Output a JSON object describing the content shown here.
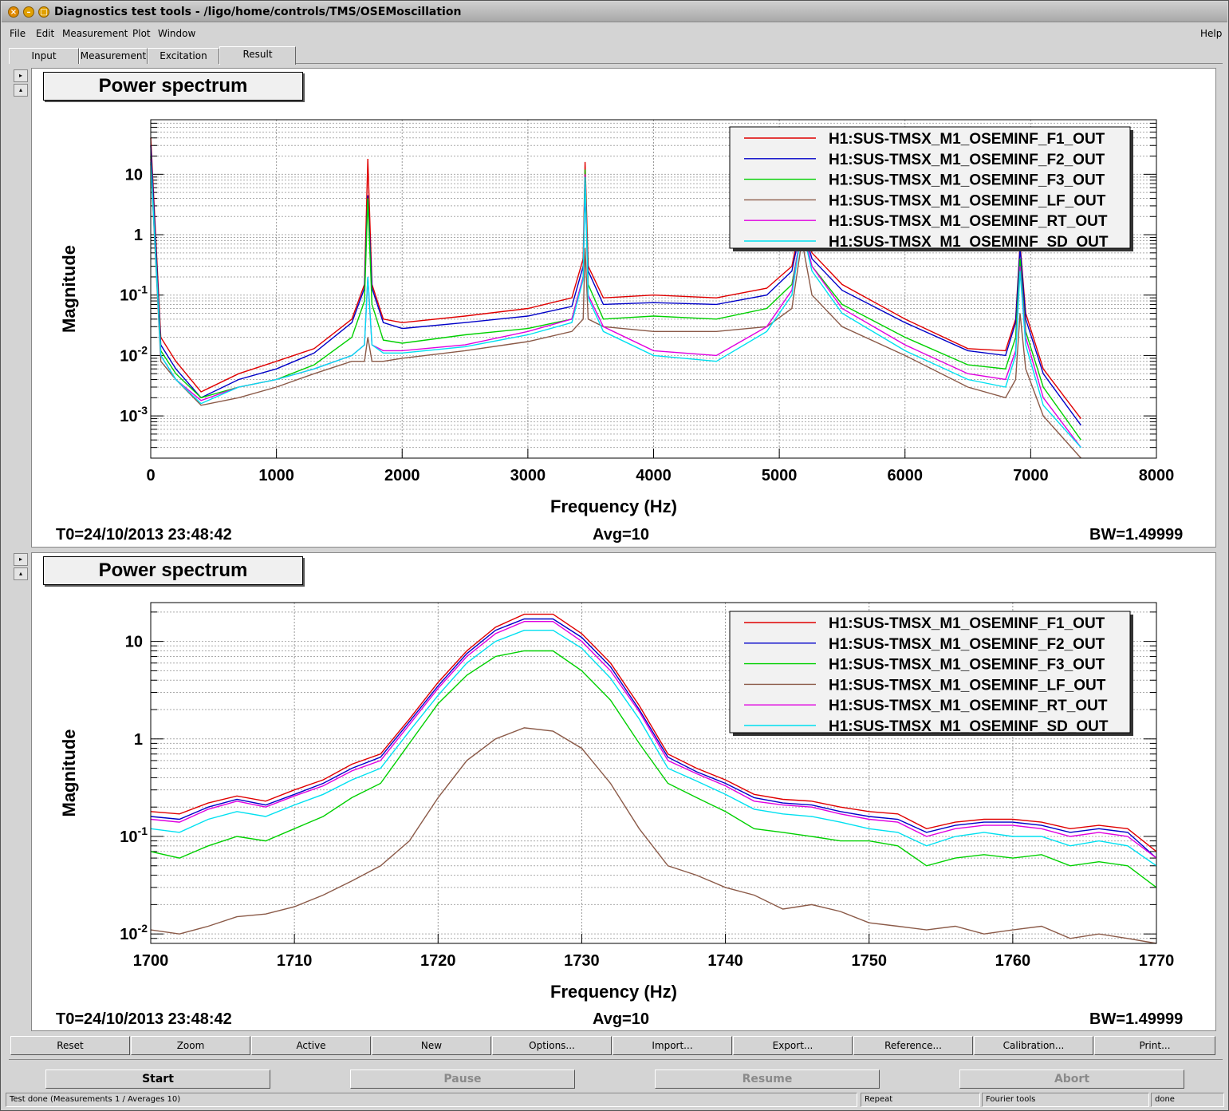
{
  "window": {
    "title": "Diagnostics test tools - /ligo/home/controls/TMS/OSEMoscillation"
  },
  "menubar": {
    "items": [
      "File",
      "Edit",
      "Measurement",
      "Plot",
      "Window"
    ],
    "help": "Help"
  },
  "tabs": [
    {
      "label": "Input",
      "active": false
    },
    {
      "label": "Measurement",
      "active": false
    },
    {
      "label": "Excitation",
      "active": false
    },
    {
      "label": "Result",
      "active": true
    }
  ],
  "legend_entries": [
    "H1:SUS-TMSX_M1_OSEMINF_F1_OUT",
    "H1:SUS-TMSX_M1_OSEMINF_F2_OUT",
    "H1:SUS-TMSX_M1_OSEMINF_F3_OUT",
    "H1:SUS-TMSX_M1_OSEMINF_LF_OUT",
    "H1:SUS-TMSX_M1_OSEMINF_RT_OUT",
    "H1:SUS-TMSX_M1_OSEMINF_SD_OUT"
  ],
  "series_colors": [
    "#e00000",
    "#0000c8",
    "#00d000",
    "#8b5a48",
    "#e000e0",
    "#00e0f0"
  ],
  "plots": [
    {
      "title": "Power spectrum",
      "t0": "T0=24/10/2013 23:48:42",
      "avg": "Avg=10",
      "bw": "BW=1.49999"
    },
    {
      "title": "Power spectrum",
      "t0": "T0=24/10/2013 23:48:42",
      "avg": "Avg=10",
      "bw": "BW=1.49999"
    }
  ],
  "chart_data": [
    {
      "type": "line",
      "title": "Power spectrum",
      "xlabel": "Frequency (Hz)",
      "ylabel": "Magnitude",
      "xlim": [
        0,
        8000
      ],
      "ylim": [
        0.0002,
        80
      ],
      "yscale": "log",
      "grid": true,
      "legend": "top-right",
      "xticks": [
        "0",
        "1000",
        "2000",
        "3000",
        "4000",
        "5000",
        "6000",
        "7000",
        "8000"
      ],
      "xtick_values": [
        0,
        1000,
        2000,
        3000,
        4000,
        5000,
        6000,
        7000,
        8000
      ],
      "ytick_values": [
        0.001,
        0.01,
        0.1,
        1,
        10
      ],
      "series": [
        {
          "name": "H1:SUS-TMSX_M1_OSEMINF_F1_OUT",
          "x": [
            0,
            80,
            200,
            400,
            700,
            1000,
            1300,
            1600,
            1700,
            1727,
            1760,
            1850,
            2000,
            2500,
            3000,
            3350,
            3440,
            3455,
            3480,
            3600,
            4000,
            4500,
            4900,
            5100,
            5180,
            5260,
            5500,
            6000,
            6500,
            6800,
            6880,
            6915,
            6960,
            7100,
            7400
          ],
          "y": [
            40,
            0.02,
            0.008,
            0.0025,
            0.005,
            0.008,
            0.013,
            0.04,
            0.15,
            18,
            0.15,
            0.04,
            0.035,
            0.045,
            0.06,
            0.09,
            0.4,
            16,
            0.3,
            0.09,
            0.1,
            0.09,
            0.13,
            0.3,
            2,
            0.5,
            0.15,
            0.04,
            0.013,
            0.012,
            0.04,
            0.7,
            0.05,
            0.006,
            0.0009
          ]
        },
        {
          "name": "H1:SUS-TMSX_M1_OSEMINF_F2_OUT",
          "x": [
            0,
            80,
            200,
            400,
            700,
            1000,
            1300,
            1600,
            1700,
            1727,
            1760,
            1850,
            2000,
            2500,
            3000,
            3350,
            3440,
            3455,
            3480,
            3600,
            4000,
            4500,
            4900,
            5100,
            5180,
            5260,
            5500,
            6000,
            6500,
            6800,
            6880,
            6915,
            6960,
            7100,
            7400
          ],
          "y": [
            30,
            0.015,
            0.006,
            0.002,
            0.004,
            0.006,
            0.011,
            0.035,
            0.13,
            4.5,
            0.13,
            0.035,
            0.028,
            0.035,
            0.045,
            0.065,
            0.3,
            5,
            0.25,
            0.07,
            0.075,
            0.07,
            0.1,
            0.25,
            1.6,
            0.4,
            0.12,
            0.035,
            0.012,
            0.01,
            0.035,
            0.6,
            0.04,
            0.005,
            0.0007
          ]
        },
        {
          "name": "H1:SUS-TMSX_M1_OSEMINF_F3_OUT",
          "x": [
            0,
            80,
            200,
            400,
            700,
            1000,
            1300,
            1600,
            1700,
            1727,
            1760,
            1850,
            2000,
            2500,
            3000,
            3350,
            3440,
            3455,
            3480,
            3600,
            4000,
            4500,
            4900,
            5100,
            5180,
            5260,
            5500,
            6000,
            6500,
            6800,
            6880,
            6915,
            6960,
            7100,
            7400
          ],
          "y": [
            20,
            0.012,
            0.005,
            0.002,
            0.003,
            0.004,
            0.007,
            0.02,
            0.08,
            4,
            0.07,
            0.018,
            0.016,
            0.022,
            0.028,
            0.04,
            0.2,
            12,
            0.15,
            0.04,
            0.045,
            0.04,
            0.06,
            0.15,
            1.2,
            0.3,
            0.07,
            0.02,
            0.007,
            0.006,
            0.02,
            0.4,
            0.025,
            0.003,
            0.0004
          ]
        },
        {
          "name": "H1:SUS-TMSX_M1_OSEMINF_LF_OUT",
          "x": [
            0,
            80,
            200,
            400,
            700,
            1000,
            1300,
            1600,
            1700,
            1727,
            1760,
            1850,
            2000,
            2500,
            3000,
            3350,
            3440,
            3455,
            3480,
            3600,
            4000,
            4500,
            4900,
            5100,
            5180,
            5260,
            5500,
            6000,
            6500,
            6800,
            6880,
            6915,
            6960,
            7100,
            7400
          ],
          "y": [
            15,
            0.008,
            0.004,
            0.0015,
            0.002,
            0.003,
            0.005,
            0.008,
            0.008,
            0.02,
            0.008,
            0.008,
            0.009,
            0.012,
            0.017,
            0.025,
            0.04,
            0.6,
            0.04,
            0.03,
            0.025,
            0.025,
            0.03,
            0.06,
            0.8,
            0.1,
            0.03,
            0.01,
            0.003,
            0.002,
            0.004,
            0.05,
            0.006,
            0.001,
            0.0002
          ]
        },
        {
          "name": "H1:SUS-TMSX_M1_OSEMINF_RT_OUT",
          "x": [
            0,
            80,
            200,
            400,
            700,
            1000,
            1300,
            1600,
            1700,
            1727,
            1760,
            1850,
            2000,
            2500,
            3000,
            3350,
            3440,
            3455,
            3480,
            3600,
            4000,
            4500,
            4900,
            5100,
            5180,
            5260,
            5500,
            6000,
            6500,
            6800,
            6880,
            6915,
            6960,
            7100,
            7400
          ],
          "y": [
            18,
            0.01,
            0.004,
            0.0018,
            0.003,
            0.004,
            0.006,
            0.01,
            0.015,
            0.2,
            0.015,
            0.012,
            0.012,
            0.015,
            0.025,
            0.04,
            0.2,
            10,
            0.1,
            0.03,
            0.012,
            0.01,
            0.03,
            0.12,
            1.5,
            0.3,
            0.06,
            0.015,
            0.005,
            0.004,
            0.012,
            0.3,
            0.02,
            0.002,
            0.0003
          ]
        },
        {
          "name": "H1:SUS-TMSX_M1_OSEMINF_SD_OUT",
          "x": [
            0,
            80,
            200,
            400,
            700,
            1000,
            1300,
            1600,
            1700,
            1727,
            1760,
            1850,
            2000,
            2500,
            3000,
            3350,
            3440,
            3455,
            3480,
            3600,
            4000,
            4500,
            4900,
            5100,
            5180,
            5260,
            5500,
            6000,
            6500,
            6800,
            6880,
            6915,
            6960,
            7100,
            7400
          ],
          "y": [
            16,
            0.01,
            0.004,
            0.0016,
            0.003,
            0.004,
            0.006,
            0.01,
            0.015,
            0.2,
            0.015,
            0.011,
            0.011,
            0.014,
            0.022,
            0.035,
            0.18,
            9,
            0.09,
            0.025,
            0.01,
            0.008,
            0.025,
            0.1,
            1.3,
            0.25,
            0.05,
            0.012,
            0.004,
            0.003,
            0.01,
            0.25,
            0.015,
            0.0015,
            0.0003
          ]
        }
      ]
    },
    {
      "type": "line",
      "title": "Power spectrum",
      "xlabel": "Frequency (Hz)",
      "ylabel": "Magnitude",
      "xlim": [
        1700,
        1770
      ],
      "ylim": [
        0.008,
        25
      ],
      "yscale": "log",
      "grid": true,
      "legend": "top-right",
      "xticks": [
        "1700",
        "1710",
        "1720",
        "1730",
        "1740",
        "1750",
        "1760",
        "1770"
      ],
      "xtick_values": [
        1700,
        1710,
        1720,
        1730,
        1740,
        1750,
        1760,
        1770
      ],
      "ytick_values": [
        0.01,
        0.1,
        1,
        10
      ],
      "x": [
        1700,
        1702,
        1704,
        1706,
        1708,
        1710,
        1712,
        1714,
        1716,
        1718,
        1720,
        1722,
        1724,
        1726,
        1728,
        1730,
        1732,
        1734,
        1736,
        1738,
        1740,
        1742,
        1744,
        1746,
        1748,
        1750,
        1752,
        1754,
        1756,
        1758,
        1760,
        1762,
        1764,
        1766,
        1768,
        1770
      ],
      "series": [
        {
          "name": "H1:SUS-TMSX_M1_OSEMINF_F1_OUT",
          "y": [
            0.18,
            0.17,
            0.22,
            0.26,
            0.23,
            0.3,
            0.38,
            0.55,
            0.7,
            1.6,
            3.8,
            8,
            14,
            19,
            19,
            12,
            6,
            2.2,
            0.7,
            0.5,
            0.38,
            0.27,
            0.24,
            0.23,
            0.2,
            0.18,
            0.17,
            0.12,
            0.14,
            0.15,
            0.15,
            0.14,
            0.12,
            0.13,
            0.12,
            0.07
          ]
        },
        {
          "name": "H1:SUS-TMSX_M1_OSEMINF_F2_OUT",
          "y": [
            0.16,
            0.15,
            0.2,
            0.24,
            0.21,
            0.27,
            0.35,
            0.5,
            0.65,
            1.5,
            3.5,
            7.5,
            13,
            17,
            17,
            11,
            5.5,
            2,
            0.65,
            0.46,
            0.35,
            0.25,
            0.22,
            0.21,
            0.18,
            0.16,
            0.15,
            0.11,
            0.13,
            0.14,
            0.14,
            0.13,
            0.11,
            0.12,
            0.11,
            0.06
          ]
        },
        {
          "name": "H1:SUS-TMSX_M1_OSEMINF_F3_OUT",
          "y": [
            0.07,
            0.06,
            0.08,
            0.1,
            0.09,
            0.12,
            0.16,
            0.25,
            0.35,
            0.9,
            2.3,
            4.5,
            7,
            8,
            8,
            5,
            2.5,
            0.9,
            0.35,
            0.25,
            0.18,
            0.12,
            0.11,
            0.1,
            0.09,
            0.09,
            0.08,
            0.05,
            0.06,
            0.065,
            0.06,
            0.065,
            0.05,
            0.055,
            0.05,
            0.03
          ]
        },
        {
          "name": "H1:SUS-TMSX_M1_OSEMINF_LF_OUT",
          "y": [
            0.011,
            0.01,
            0.012,
            0.015,
            0.016,
            0.019,
            0.025,
            0.035,
            0.05,
            0.09,
            0.25,
            0.6,
            1,
            1.3,
            1.2,
            0.8,
            0.35,
            0.12,
            0.05,
            0.04,
            0.03,
            0.025,
            0.018,
            0.02,
            0.017,
            0.013,
            0.012,
            0.011,
            0.012,
            0.01,
            0.011,
            0.012,
            0.009,
            0.01,
            0.009,
            0.008
          ]
        },
        {
          "name": "H1:SUS-TMSX_M1_OSEMINF_RT_OUT",
          "y": [
            0.15,
            0.14,
            0.19,
            0.23,
            0.2,
            0.26,
            0.33,
            0.47,
            0.6,
            1.4,
            3.3,
            7,
            12,
            16,
            16,
            10,
            5,
            1.9,
            0.6,
            0.44,
            0.33,
            0.23,
            0.21,
            0.2,
            0.17,
            0.15,
            0.14,
            0.1,
            0.12,
            0.13,
            0.13,
            0.12,
            0.1,
            0.11,
            0.1,
            0.06
          ]
        },
        {
          "name": "H1:SUS-TMSX_M1_OSEMINF_SD_OUT",
          "y": [
            0.12,
            0.11,
            0.15,
            0.18,
            0.16,
            0.21,
            0.27,
            0.38,
            0.5,
            1.2,
            2.8,
            6,
            10,
            13,
            13,
            8.5,
            4.2,
            1.6,
            0.5,
            0.37,
            0.27,
            0.19,
            0.17,
            0.16,
            0.14,
            0.12,
            0.11,
            0.08,
            0.1,
            0.11,
            0.1,
            0.1,
            0.08,
            0.09,
            0.08,
            0.05
          ]
        }
      ]
    }
  ],
  "bottom_buttons": [
    "Reset",
    "Zoom",
    "Active",
    "New",
    "Options...",
    "Import...",
    "Export...",
    "Reference...",
    "Calibration...",
    "Print..."
  ],
  "control_buttons": [
    {
      "label": "Start",
      "enabled": true
    },
    {
      "label": "Pause",
      "enabled": false
    },
    {
      "label": "Resume",
      "enabled": false
    },
    {
      "label": "Abort",
      "enabled": false
    }
  ],
  "status": {
    "message": "Test done (Measurements 1 / Averages 10)",
    "repeat": "Repeat",
    "tool": "Fourier tools",
    "state": "done"
  }
}
